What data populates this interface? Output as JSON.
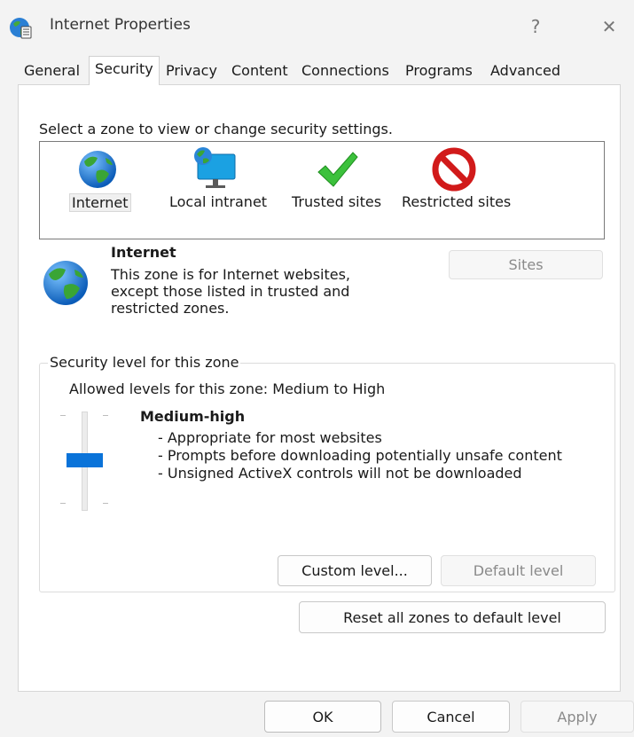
{
  "window": {
    "title": "Internet Properties",
    "help_label": "?",
    "close_label": "✕"
  },
  "tabs": [
    "General",
    "Security",
    "Privacy",
    "Content",
    "Connections",
    "Programs",
    "Advanced"
  ],
  "active_tab": "Security",
  "zones": {
    "prompt": "Select a zone to view or change security settings.",
    "items": [
      {
        "label": "Internet",
        "icon": "globe-icon",
        "selected": true
      },
      {
        "label": "Local intranet",
        "icon": "intranet-monitor-icon",
        "selected": false
      },
      {
        "label": "Trusted sites",
        "icon": "checkmark-icon",
        "selected": false
      },
      {
        "label": "Restricted sites",
        "icon": "no-entry-icon",
        "selected": false
      }
    ]
  },
  "selected_zone": {
    "title": "Internet",
    "description": "This zone is for Internet websites, except those listed in trusted and restricted zones.",
    "sites_button": "Sites"
  },
  "security_level": {
    "group_label": "Security level for this zone",
    "allowed": "Allowed levels for this zone: Medium to High",
    "level_name": "Medium-high",
    "bullets": [
      "- Appropriate for most websites",
      "- Prompts before downloading potentially unsafe content",
      "- Unsigned ActiveX controls will not be downloaded"
    ],
    "slider_level": "Medium-high",
    "custom_button": "Custom level...",
    "default_button": "Default level"
  },
  "reset_button": "Reset all zones to default level",
  "footer": {
    "ok": "OK",
    "cancel": "Cancel",
    "apply": "Apply"
  },
  "colors": {
    "accent": "#0a73d9",
    "window_bg": "#f3f3f3",
    "panel_bg": "#ffffff"
  }
}
